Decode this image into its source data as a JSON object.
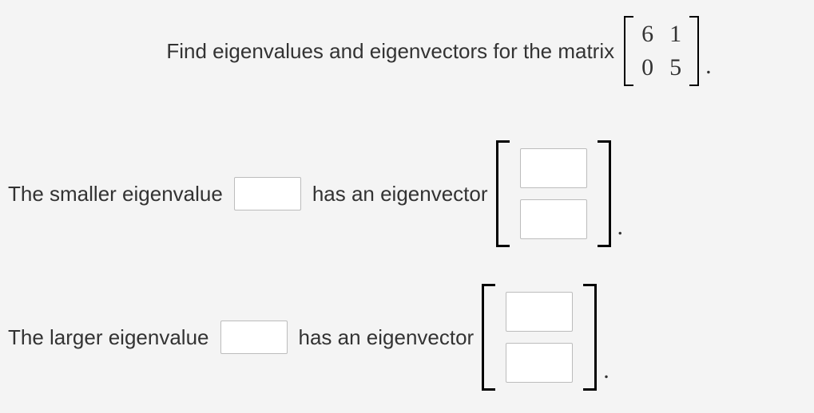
{
  "prompt": {
    "text": "Find eigenvalues and eigenvectors for the matrix",
    "matrix": {
      "a11": "6",
      "a12": "1",
      "a21": "0",
      "a22": "5"
    },
    "period": "."
  },
  "rows": {
    "smaller": {
      "label_before": "The smaller eigenvalue",
      "label_after": "has an eigenvector",
      "period": "."
    },
    "larger": {
      "label_before": "The larger eigenvalue",
      "label_after": "has an eigenvector",
      "period": "."
    }
  }
}
